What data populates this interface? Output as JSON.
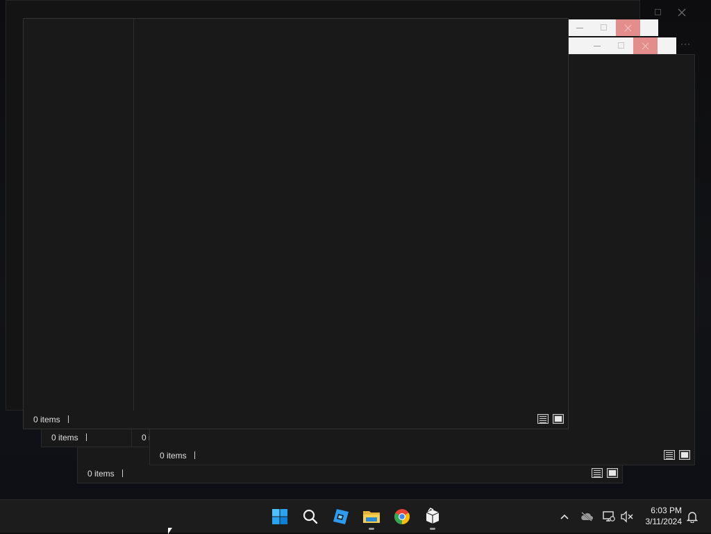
{
  "windows": [
    {
      "id": "win-bottom",
      "status_count": "0 items"
    },
    {
      "id": "win-left-small",
      "status_count": "0 items"
    },
    {
      "id": "win-mid",
      "status_count": "0 i"
    },
    {
      "id": "win-right",
      "status_count": "0 items"
    },
    {
      "id": "win-front",
      "status_count": "0 items"
    }
  ],
  "taskbar": {
    "apps": [
      {
        "name": "start",
        "icon": "windows-logo"
      },
      {
        "name": "search",
        "icon": "search-icon"
      },
      {
        "name": "roblox-studio",
        "icon": "roblox-studio-icon"
      },
      {
        "name": "file-explorer",
        "icon": "folder-icon",
        "running": true
      },
      {
        "name": "chrome",
        "icon": "chrome-icon"
      },
      {
        "name": "package-app",
        "icon": "box-icon",
        "running": true
      }
    ],
    "tray": {
      "chevron": "^",
      "time": "6:03 PM",
      "date": "3/11/2024"
    }
  },
  "colors": {
    "accent": "#0078d4",
    "close_button": "#e48d8d"
  }
}
